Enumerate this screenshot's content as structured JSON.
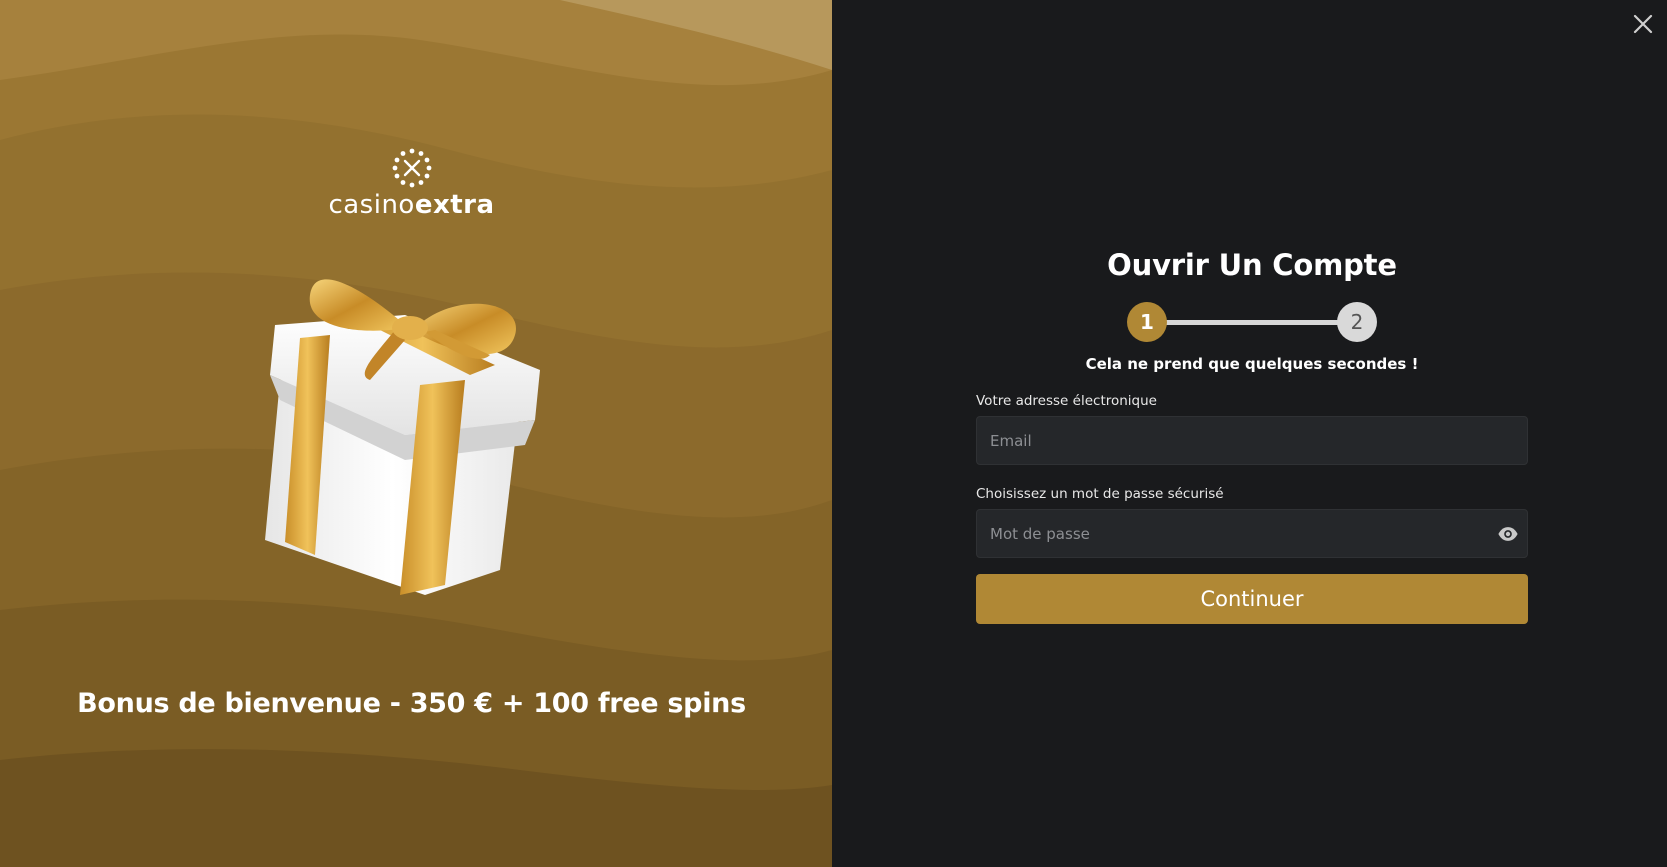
{
  "promo": {
    "logo_text_light": "casino",
    "logo_text_bold": "extra",
    "title": "Bonus de bienvenue - 350 € + 100 free spins"
  },
  "form": {
    "title": "Ouvrir Un Compte",
    "steps": [
      "1",
      "2"
    ],
    "subtitle": "Cela ne prend que quelques secondes !",
    "email_label": "Votre adresse électronique",
    "email_placeholder": "Email",
    "password_label": "Choisissez un mot de passe sécurisé",
    "password_placeholder": "Mot de passe",
    "continue_label": "Continuer"
  },
  "colors": {
    "accent": "#b08835",
    "panel_bg": "#191a1c",
    "input_bg": "#25272a"
  },
  "icons": {
    "close": "close-icon",
    "eye": "eye-icon",
    "logo": "casinoextra-logo-icon",
    "gift": "gift-box-icon"
  }
}
